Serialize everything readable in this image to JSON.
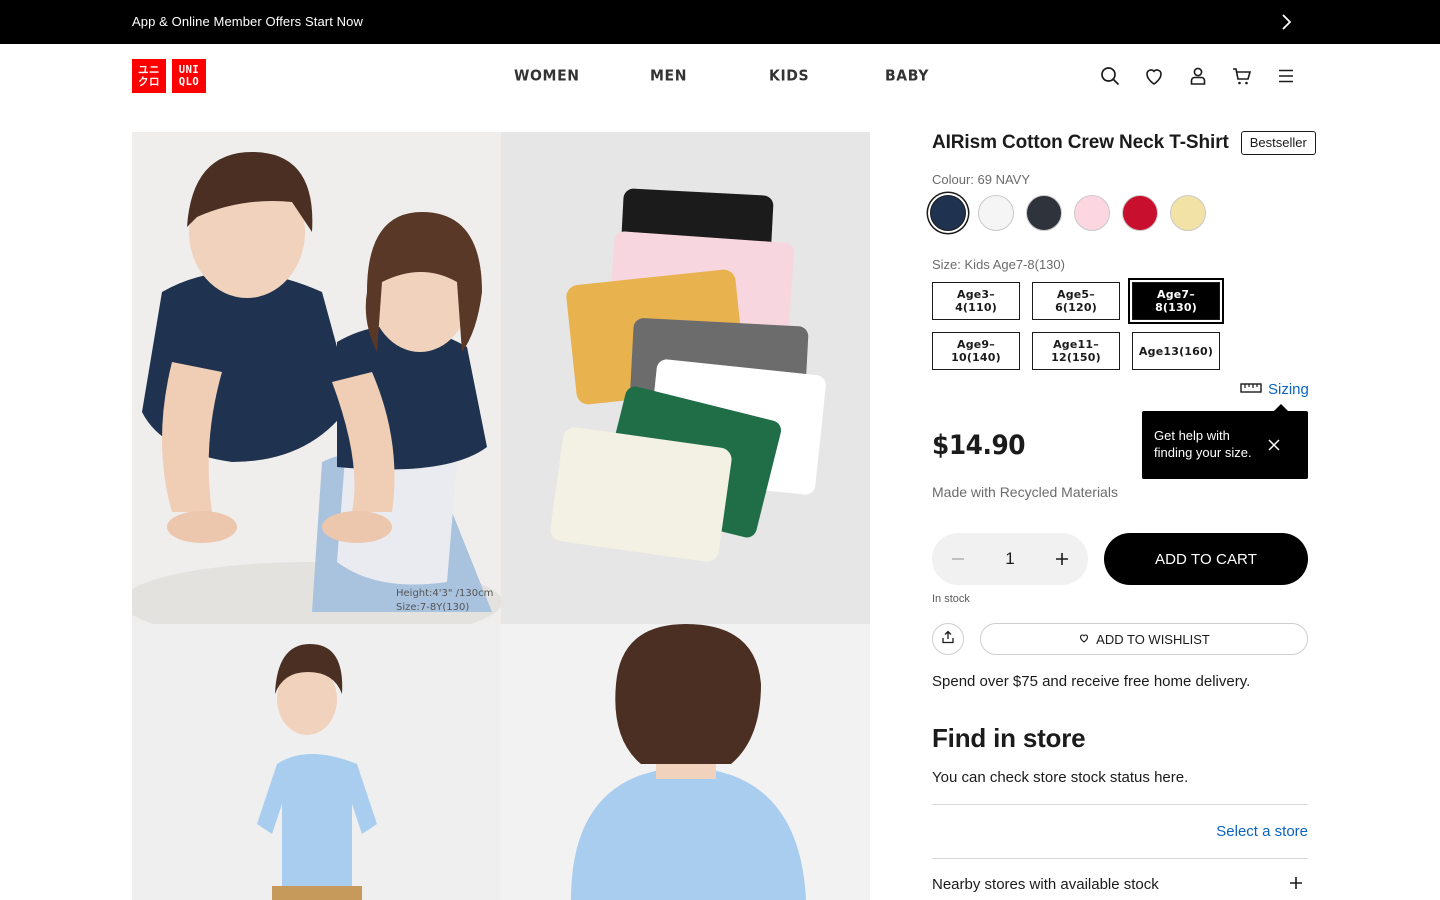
{
  "announcement": {
    "text": "App & Online Member Offers Start Now"
  },
  "logo": {
    "line1_left": "ユニ",
    "line2_left": "クロ",
    "line1_right": "UNI",
    "line2_right": "QLO"
  },
  "nav": {
    "items": [
      "WOMEN",
      "MEN",
      "KIDS",
      "BABY"
    ]
  },
  "header_icons": [
    "search-icon",
    "heart-icon",
    "account-icon",
    "cart-icon",
    "menu-icon"
  ],
  "gallery": {
    "photo1_caption_line1": "Height:4'3\" /130cm",
    "photo1_caption_line2": "Size:7-8Y(130)"
  },
  "product": {
    "title": "AIRism Cotton Crew Neck T-Shirt",
    "badge": "Bestseller",
    "colour_label": "Colour: 69 NAVY",
    "colours": [
      {
        "name": "navy",
        "hex": "#1f3350",
        "selected": true
      },
      {
        "name": "white",
        "hex": "#f5f5f5",
        "selected": false
      },
      {
        "name": "dark-grey",
        "hex": "#2f333b",
        "selected": false
      },
      {
        "name": "pink",
        "hex": "#fcd7e2",
        "selected": false
      },
      {
        "name": "red",
        "hex": "#c8102e",
        "selected": false
      },
      {
        "name": "yellow",
        "hex": "#f3e2a6",
        "selected": false
      }
    ],
    "size_label": "Size: Kids Age7-8(130)",
    "sizes": [
      {
        "label": "Age3–4(110)",
        "selected": false
      },
      {
        "label": "Age5–6(120)",
        "selected": false
      },
      {
        "label": "Age7–8(130)",
        "selected": true
      },
      {
        "label": "Age9–10(140)",
        "selected": false
      },
      {
        "label": "Age11–12(150)",
        "selected": false
      },
      {
        "label": "Age13(160)",
        "selected": false
      }
    ],
    "sizing_link": "Sizing",
    "tooltip_text": "Get help with finding your size.",
    "price": "$14.90",
    "materials": "Made with Recycled Materials",
    "quantity": "1",
    "add_to_cart": "ADD TO CART",
    "stock_status": "In stock",
    "wishlist": "ADD TO WISHLIST",
    "delivery": "Spend over $75 and receive free home delivery."
  },
  "store": {
    "title": "Find in store",
    "subtitle": "You can check store stock status here.",
    "select_link": "Select a store",
    "nearby_label": "Nearby stores with available stock"
  },
  "colors": {
    "accent_link": "#0b63c1",
    "brand_red": "#ff0000"
  }
}
